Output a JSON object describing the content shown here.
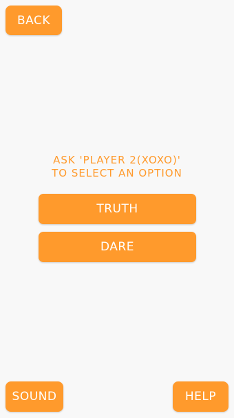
{
  "top_bar": {
    "back_label": "BACK"
  },
  "prompt": {
    "line1": "ASK 'PLAYER 2(XOXO)'",
    "line2": "TO SELECT AN OPTION"
  },
  "options": [
    {
      "label": "TRUTH"
    },
    {
      "label": "DARE"
    }
  ],
  "bottom_bar": {
    "sound_label": "SOUND",
    "help_label": "HELP"
  },
  "colors": {
    "accent": "#ff9a2c",
    "background": "#f8f8f8",
    "button_text": "#ffffff"
  }
}
